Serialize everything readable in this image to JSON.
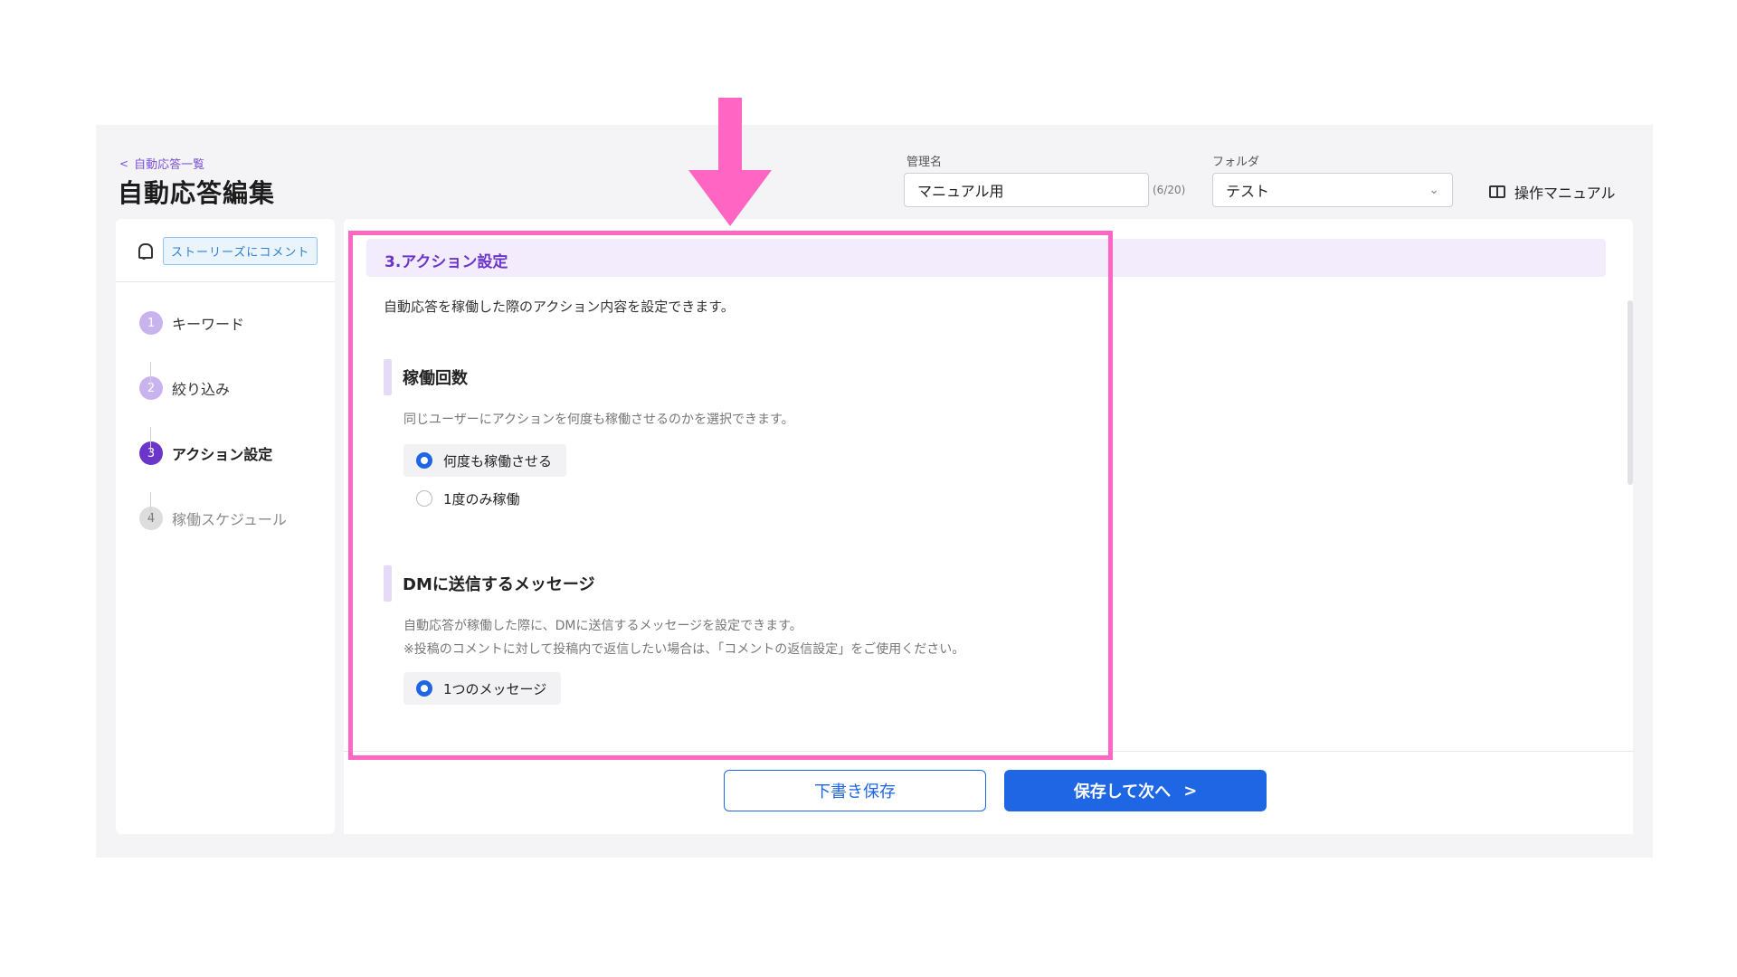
{
  "header": {
    "back_label": "自動応答一覧",
    "page_title": "自動応答編集",
    "name_label": "管理名",
    "name_value": "マニュアル用",
    "name_counter": "(6/20)",
    "folder_label": "フォルダ",
    "folder_value": "テスト",
    "manual_label": "操作マニュアル"
  },
  "sidebar": {
    "trigger_badge": "ストーリーズにコメント",
    "steps": [
      {
        "num": "1",
        "label": "キーワード",
        "state": "done"
      },
      {
        "num": "2",
        "label": "絞り込み",
        "state": "done"
      },
      {
        "num": "3",
        "label": "アクション設定",
        "state": "active"
      },
      {
        "num": "4",
        "label": "稼働スケジュール",
        "state": "todo"
      }
    ]
  },
  "main": {
    "section_title": "3.アクション設定",
    "intro": "自動応答を稼働した際のアクション内容を設定できます。",
    "run_count": {
      "title": "稼働回数",
      "desc": "同じユーザーにアクションを何度も稼働させるのかを選択できます。",
      "options": [
        "何度も稼働させる",
        "1度のみ稼働"
      ],
      "selected": "何度も稼働させる"
    },
    "dm_message": {
      "title": "DMに送信するメッセージ",
      "desc_line1": "自動応答が稼働した際に、DMに送信するメッセージを設定できます。",
      "desc_line2": "※投稿のコメントに対して投稿内で返信したい場合は、「コメントの返信設定」をご使用ください。",
      "options": [
        "1つのメッセージ"
      ],
      "selected": "1つのメッセージ"
    }
  },
  "footer": {
    "draft_label": "下書き保存",
    "next_label": "保存して次へ",
    "next_arrow": ">"
  },
  "colors": {
    "accent": "#6b35c9",
    "primary": "#1f66e5",
    "annotation": "#ff66c4"
  }
}
